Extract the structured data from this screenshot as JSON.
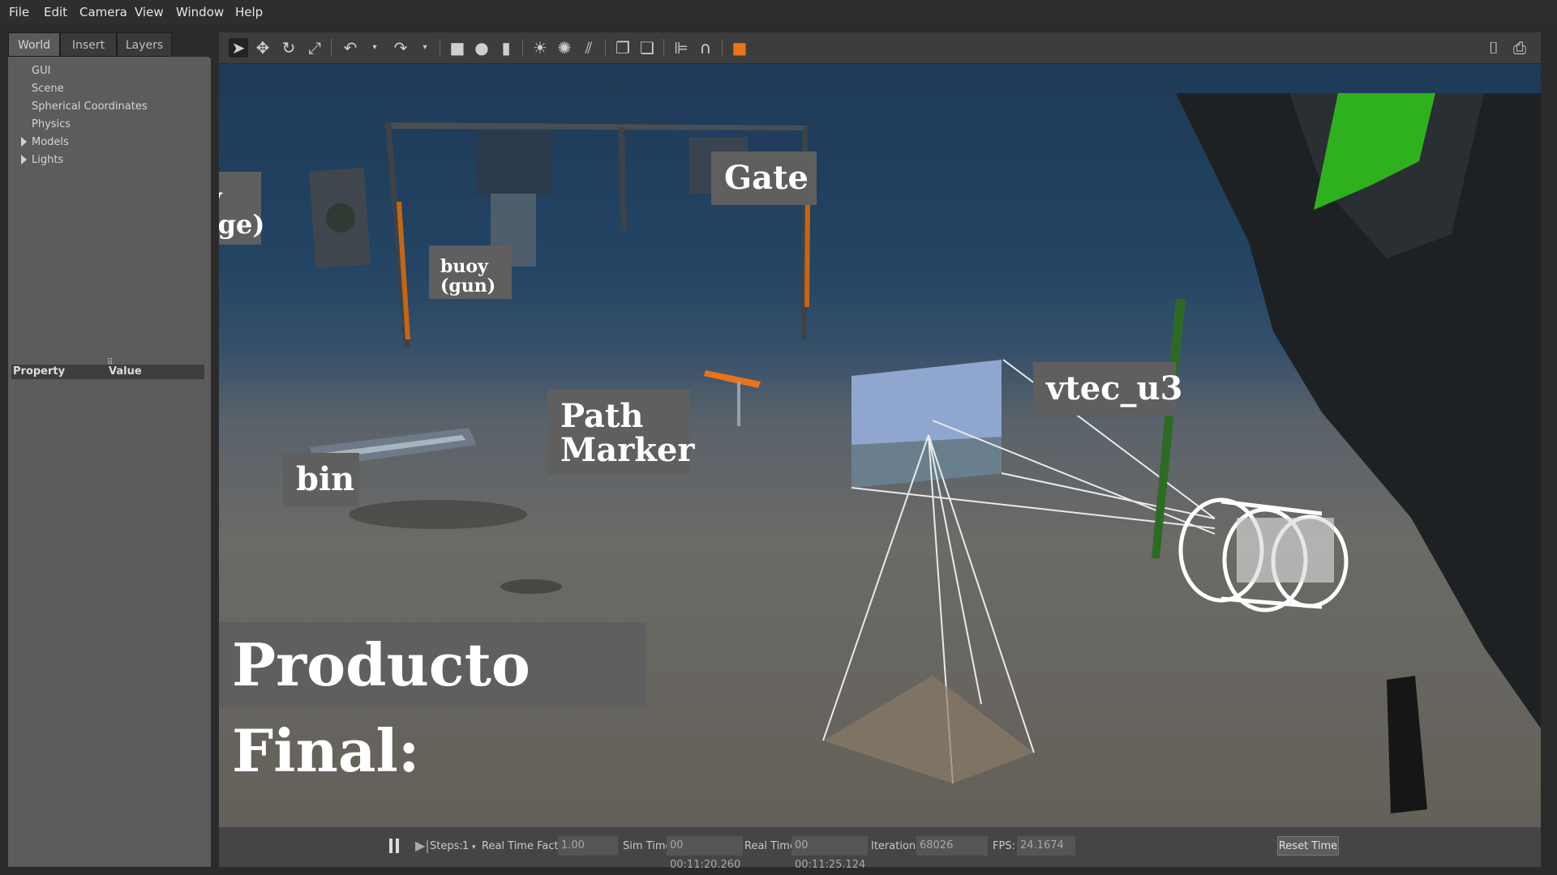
{
  "menu": {
    "file": "File",
    "edit": "Edit",
    "camera": "Camera",
    "view": "View",
    "window": "Window",
    "help": "Help"
  },
  "left_panel": {
    "tabs": [
      "World",
      "Insert",
      "Layers"
    ],
    "tree": [
      "GUI",
      "Scene",
      "Spherical Coordinates",
      "Physics",
      "Models",
      "Lights"
    ],
    "property_header": "Property",
    "value_header": "Value",
    "splitter_glyph": "⠿"
  },
  "toolbar": {
    "icons": [
      "select-arrow-icon",
      "translate-icon",
      "rotate-icon",
      "scale-icon",
      "undo-icon",
      "redo-icon",
      "box-icon",
      "sphere-icon",
      "cylinder-icon",
      "point-light-icon",
      "spot-light-icon",
      "directional-light-icon",
      "copy-icon",
      "paste-icon",
      "align-icon",
      "snap-icon",
      "view-angle-icon",
      "screenshot-icon",
      "record-icon"
    ]
  },
  "overlay_labels": {
    "buoy_badge": "buoy\n(badge)",
    "buoy_gun": "buoy\n(gun)",
    "gate": "Gate",
    "path_marker": "Path\nMarker",
    "bin": "bin",
    "vtec": "vtec_u3",
    "title": "Producto Final:"
  },
  "bottom_bar": {
    "steps_label": "Steps:",
    "steps_value": "1",
    "rtf_label": "Real Time Factor:",
    "rtf_value": "1.00",
    "sim_time_label": "Sim Time:",
    "sim_time_value": "00 00:11:20.260",
    "real_time_label": "Real Time:",
    "real_time_value": "00 00:11:25.124",
    "iterations_label": "Iterations:",
    "iterations_value": "68026",
    "fps_label": "FPS:",
    "fps_value": "24.1674",
    "reset_label": "Reset Time"
  },
  "colors": {
    "accent_orange": "#e8741c",
    "viewport_water": "#234463",
    "seafloor": "#635f58"
  }
}
